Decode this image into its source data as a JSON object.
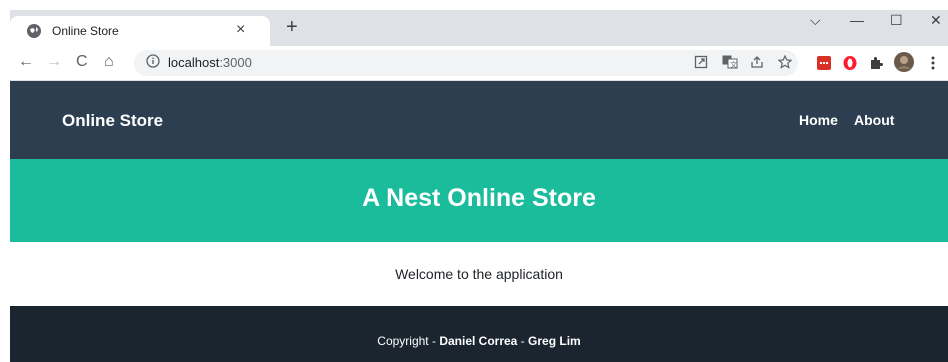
{
  "browser": {
    "tab_title": "Online Store",
    "tab_close": "×",
    "new_tab": "+",
    "url_host": "localhost",
    "url_port": ":3000",
    "window_controls": {
      "dropdown": "⌵",
      "minimize": "—",
      "maximize": "☐",
      "close": "✕"
    },
    "nav": {
      "back": "←",
      "forward": "→",
      "reload": "C",
      "home": "⌂"
    },
    "icons": [
      "open-in-app-icon",
      "translate-icon",
      "share-icon",
      "bookmark-star-icon",
      "extension-red-icon",
      "opera-icon",
      "extensions-puzzle-icon",
      "profile-avatar-icon",
      "menu-icon"
    ]
  },
  "navbar": {
    "brand": "Online Store",
    "links": [
      "Home",
      "About"
    ]
  },
  "hero": {
    "title": "A Nest Online Store"
  },
  "main": {
    "welcome": "Welcome to the application"
  },
  "footer": {
    "prefix": "Copyright - ",
    "author1": "Daniel Correa",
    "separator": " - ",
    "author2": "Greg Lim"
  },
  "colors": {
    "navbar": "#2c3e50",
    "hero": "#1abc9c",
    "footer": "#1a252f"
  }
}
